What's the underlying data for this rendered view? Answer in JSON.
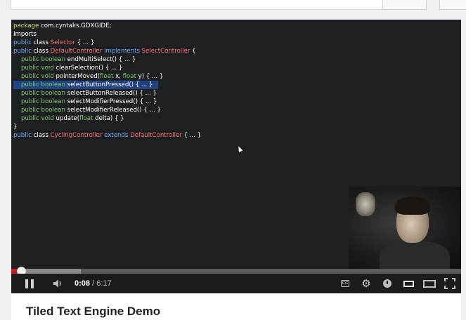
{
  "video": {
    "title": "Tiled Text Engine Demo",
    "time_current": "0:08",
    "time_separator": " / ",
    "time_total": "6:17",
    "progress_played_fraction": 0.021,
    "progress_loaded_fraction": 0.155
  },
  "code_lines": [
    [
      [
        "k-pkg",
        "package"
      ],
      [
        "k-wht",
        " com.cyntaks.GDXGIDE;"
      ]
    ],
    [
      [
        "k-wht",
        "Imports"
      ]
    ],
    [
      [
        "k-kw",
        "public"
      ],
      [
        "k-wht",
        " class "
      ],
      [
        "k-cls",
        "Selector"
      ],
      [
        "k-wht",
        " { ... }"
      ]
    ],
    [
      [
        "k-kw",
        "public"
      ],
      [
        "k-wht",
        " class "
      ],
      [
        "k-cls",
        "DefaultController"
      ],
      [
        "k-kw",
        " implements "
      ],
      [
        "k-cls",
        "SelectController"
      ],
      [
        "k-wht",
        " {"
      ]
    ],
    [
      [
        "k-wht",
        "    "
      ],
      [
        "k-grn",
        "public boolean"
      ],
      [
        "k-wht",
        " endMultiSelect() { ... }"
      ]
    ],
    [
      [
        "k-wht",
        "    "
      ],
      [
        "k-grn",
        "public void"
      ],
      [
        "k-wht",
        " clearSelection() { ... }"
      ]
    ],
    [
      [
        "k-wht",
        "    "
      ],
      [
        "k-grn",
        "public void"
      ],
      [
        "k-wht",
        " pointerMoved("
      ],
      [
        "k-grn",
        "float"
      ],
      [
        "k-wht",
        " x, "
      ],
      [
        "k-grn",
        "float"
      ],
      [
        "k-wht",
        " y) { ... }"
      ]
    ],
    [
      [
        "k-wht",
        "    "
      ],
      [
        "k-grn",
        "public boolean"
      ],
      [
        "k-wht",
        " selectButtonPressed() { ... }"
      ]
    ],
    [
      [
        "k-wht",
        "    "
      ],
      [
        "k-grn",
        "public boolean"
      ],
      [
        "k-wht",
        " selectButtonReleased() { ... }"
      ]
    ],
    [
      [
        "k-wht",
        "    "
      ],
      [
        "k-grn",
        "public boolean"
      ],
      [
        "k-wht",
        " selectModifierPressed() { ... }"
      ]
    ],
    [
      [
        "k-wht",
        "    "
      ],
      [
        "k-grn",
        "public boolean"
      ],
      [
        "k-wht",
        " selectModifierReleased() { ... }"
      ]
    ],
    [
      [
        "k-wht",
        "    "
      ],
      [
        "k-grn",
        "public void"
      ],
      [
        "k-wht",
        " update("
      ],
      [
        "k-grn",
        "float"
      ],
      [
        "k-wht",
        " delta) { }"
      ]
    ],
    [
      [
        "k-wht",
        "}"
      ]
    ],
    [
      [
        "k-kw",
        "public"
      ],
      [
        "k-wht",
        " class "
      ],
      [
        "k-cls",
        "CyclingController"
      ],
      [
        "k-kw",
        " extends "
      ],
      [
        "k-cls",
        "DefaultController"
      ],
      [
        "k-wht",
        " { ... }"
      ]
    ]
  ],
  "selected_line_index": 7,
  "icons": {
    "pause": "pause-icon",
    "volume": "volume-icon",
    "cc": "closed-captions-icon",
    "settings": "gear-icon",
    "watch_later": "clock-icon",
    "small_player": "small-player-icon",
    "large_player": "large-player-icon",
    "fullscreen": "fullscreen-icon"
  },
  "cc_label": "CC",
  "colors": {
    "progress_played": "#cc181e",
    "code_keyword": "#67a9f0",
    "code_classname": "#ff6a6a",
    "code_type": "#77c866",
    "code_package": "#d8e243",
    "selection": "#214283"
  }
}
